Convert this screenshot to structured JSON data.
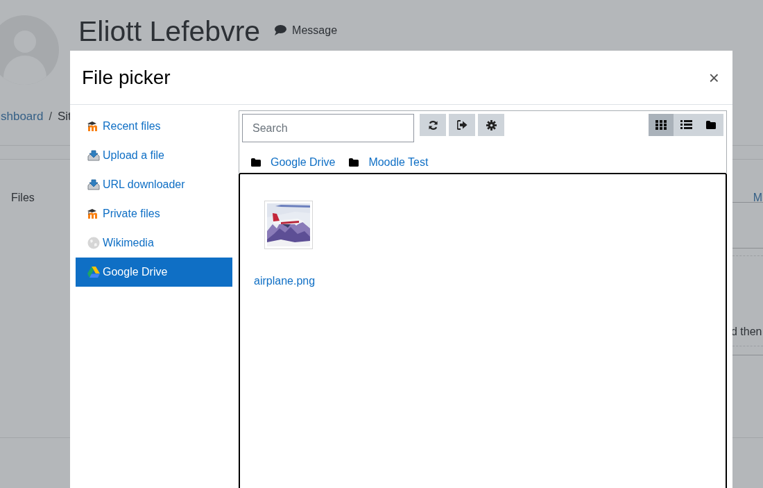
{
  "background_page": {
    "user_name": "Eliott Lefebvre",
    "message_link": "Message",
    "breadcrumb": {
      "items": [
        "shboard",
        "Sit"
      ],
      "separator": "/"
    },
    "files_label": "Files",
    "column_fragment": "M",
    "text_fragment": "d then"
  },
  "dialog": {
    "title": "File picker",
    "close": "×",
    "repositories": [
      {
        "label": "Recent files",
        "kind": "moodle",
        "selected": false
      },
      {
        "label": "Upload a file",
        "kind": "upload",
        "selected": false
      },
      {
        "label": "URL downloader",
        "kind": "upload",
        "selected": false
      },
      {
        "label": "Private files",
        "kind": "moodle",
        "selected": false
      },
      {
        "label": "Wikimedia",
        "kind": "wiki",
        "selected": false
      },
      {
        "label": "Google Drive",
        "kind": "drive",
        "selected": true
      }
    ],
    "search": {
      "placeholder": "Search"
    },
    "toolbar_buttons": [
      {
        "kind": "refresh"
      },
      {
        "kind": "logout"
      },
      {
        "kind": "settings"
      }
    ],
    "view_modes": [
      {
        "kind": "icons",
        "selected": true
      },
      {
        "kind": "list",
        "selected": false
      },
      {
        "kind": "tree",
        "selected": false
      }
    ],
    "path": [
      "Google Drive",
      "Moodle Test"
    ],
    "files": [
      {
        "name": "airplane.png",
        "kind": "picture"
      }
    ]
  }
}
